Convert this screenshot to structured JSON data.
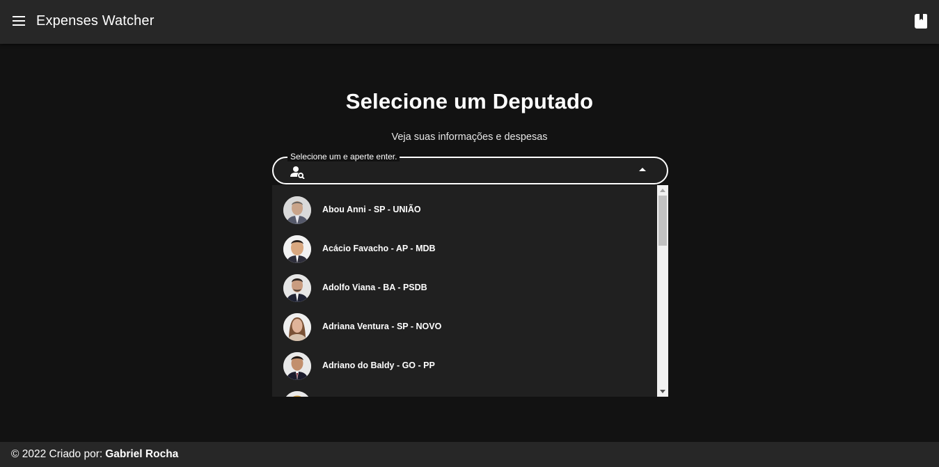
{
  "appbar": {
    "title": "Expenses Watcher",
    "menu_icon": "menu-icon",
    "right_icon": "book-icon"
  },
  "main": {
    "title": "Selecione um Deputado",
    "subtitle": "Veja suas informações e despesas"
  },
  "search": {
    "label": "Selecione um e aperte enter.",
    "value": "",
    "placeholder": "",
    "icon": "person-search-icon"
  },
  "dropdown": {
    "items": [
      {
        "label": "Abou Anni - SP - UNIÃO",
        "avatar": "avatar-photo"
      },
      {
        "label": "Acácio Favacho - AP - MDB",
        "avatar": "avatar-photo"
      },
      {
        "label": "Adolfo Viana - BA - PSDB",
        "avatar": "avatar-photo"
      },
      {
        "label": "Adriana Ventura - SP - NOVO",
        "avatar": "avatar-photo"
      },
      {
        "label": "Adriano do Baldy - GO - PP",
        "avatar": "avatar-photo"
      }
    ]
  },
  "footer": {
    "prefix": "© 2022 Criado por:",
    "author": "Gabriel Rocha"
  },
  "colors": {
    "background": "#121212",
    "appbar": "#272727",
    "dropdown": "#202020"
  }
}
